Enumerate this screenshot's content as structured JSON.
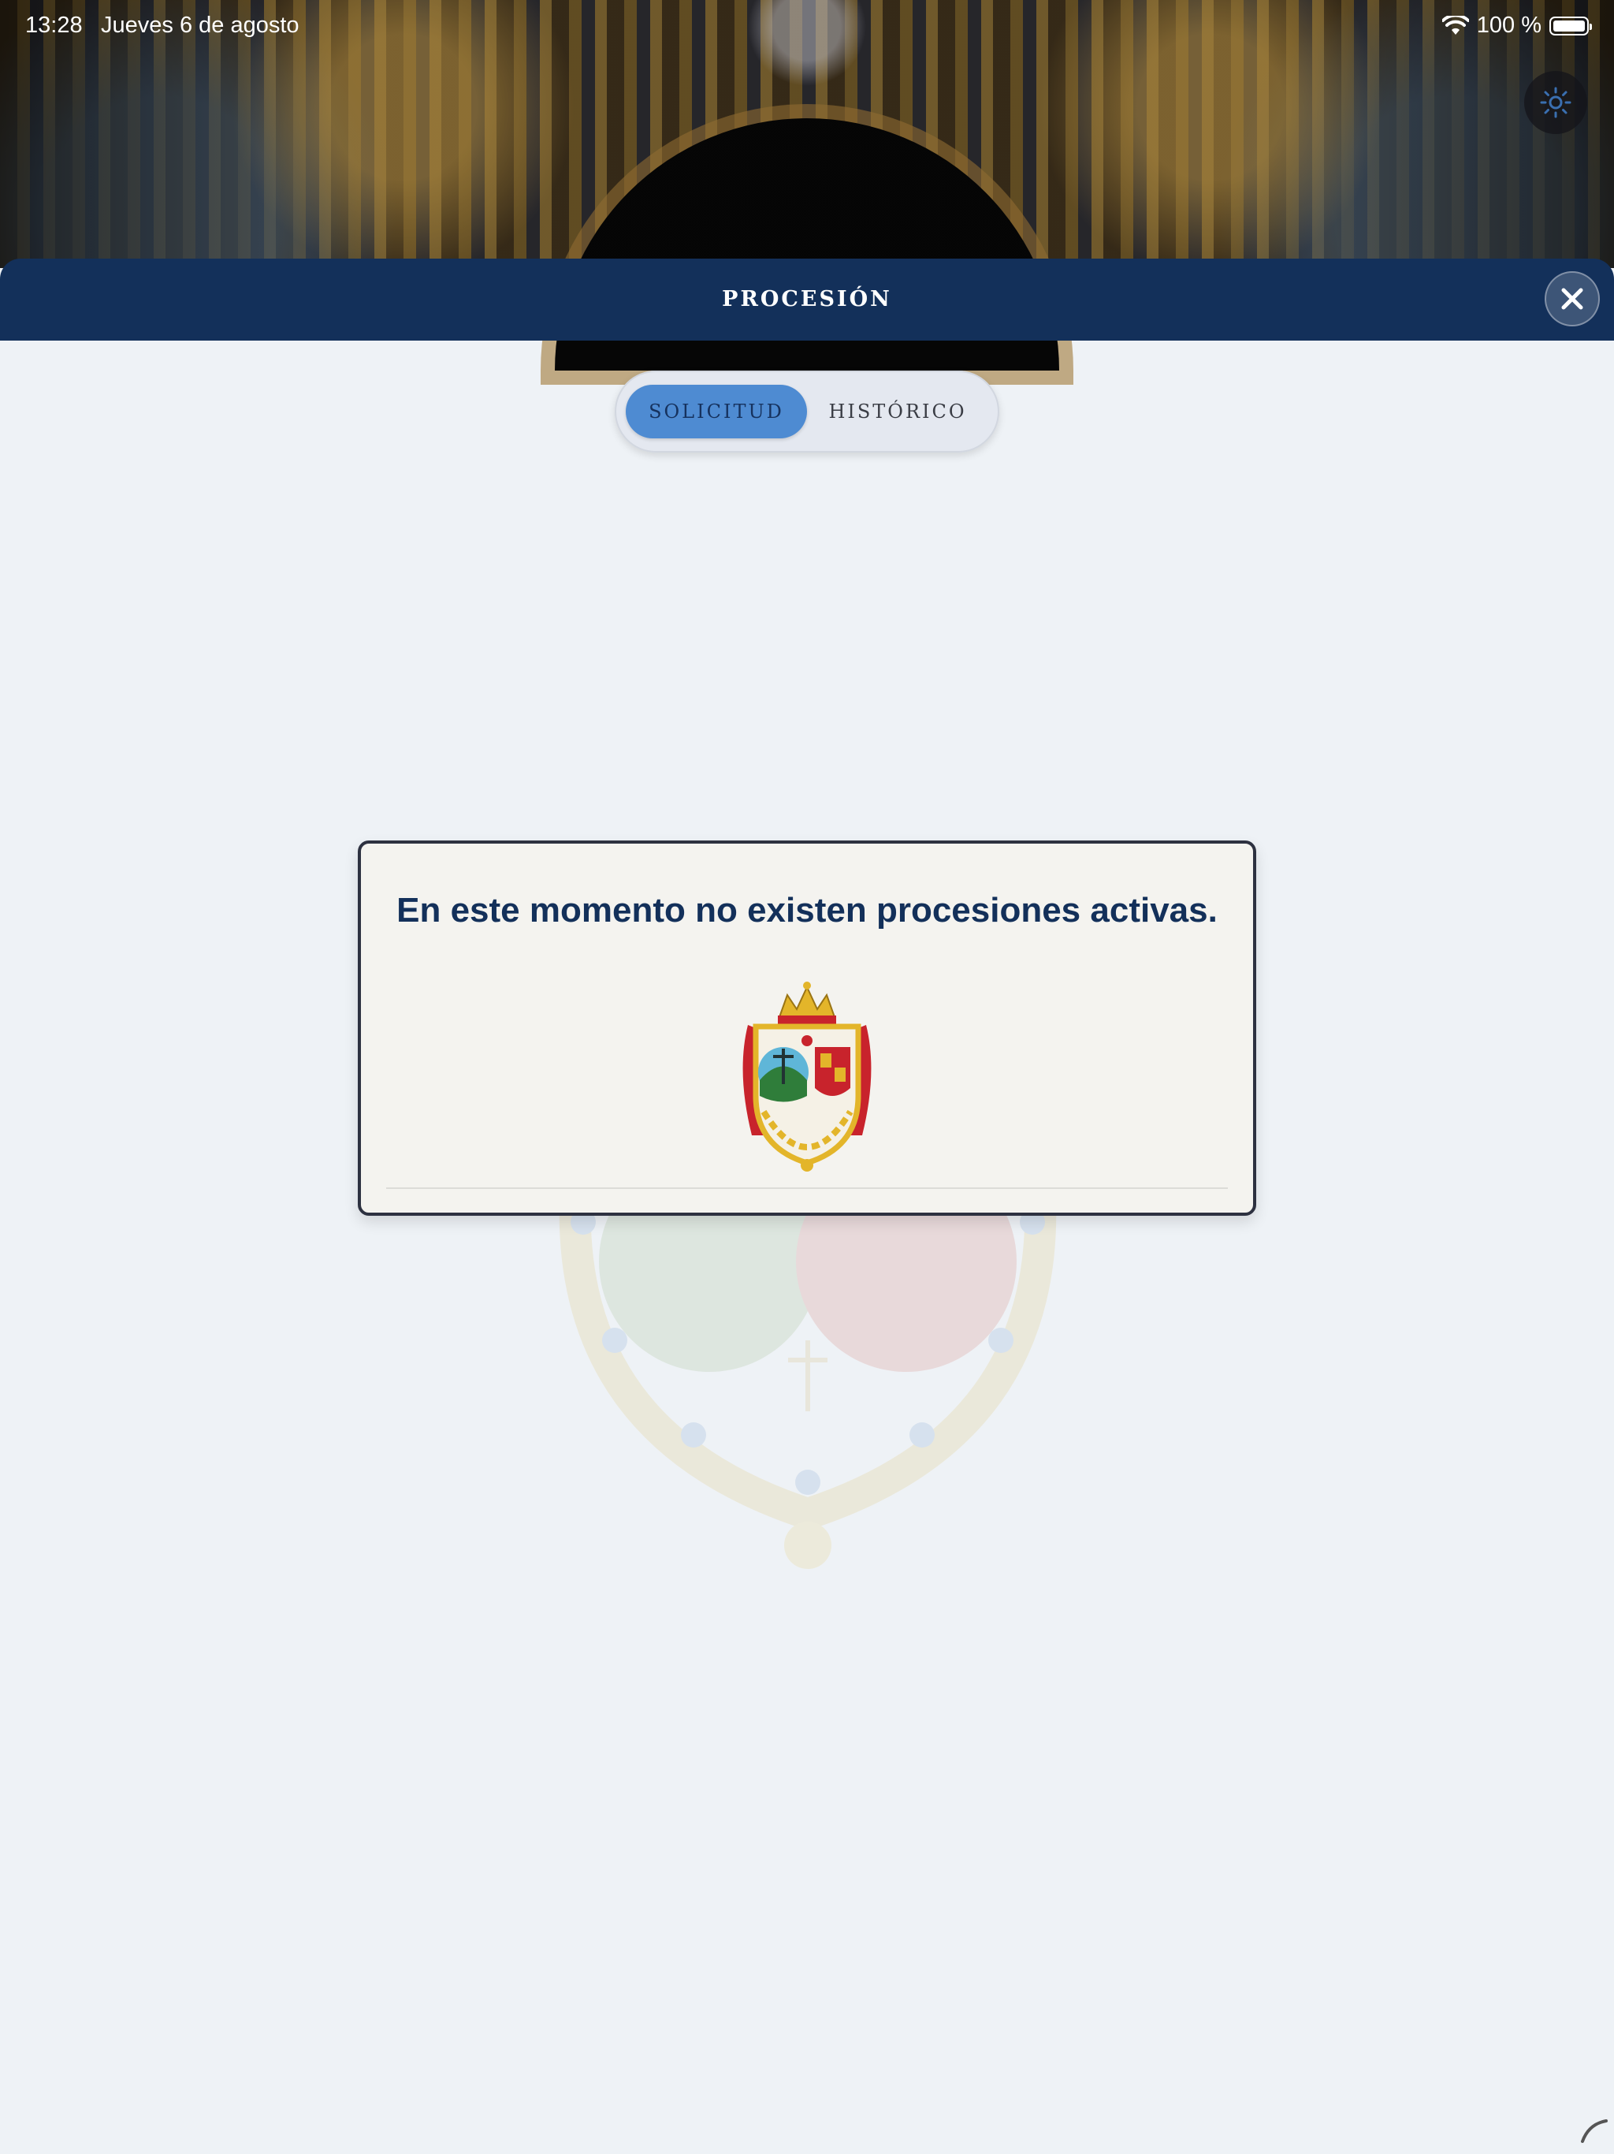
{
  "status_bar": {
    "time": "13:28",
    "date": "Jueves 6 de agosto",
    "battery": "100 %",
    "icons": [
      "wifi-icon",
      "battery-icon"
    ]
  },
  "header": {
    "title": "PROCESIÓN",
    "close_icon": "close-icon",
    "theme_icon": "sun-icon"
  },
  "tabs": [
    {
      "label": "SOLICITUD",
      "active": true
    },
    {
      "label": "HISTÓRICO",
      "active": false
    }
  ],
  "empty_state": {
    "message": "En este momento no existen procesiones activas.",
    "image": "coat-of-arms"
  },
  "colors": {
    "nav": "#13305a",
    "accent": "#4e8bd2",
    "background": "#eef2f6",
    "card": "#f4f3ef"
  }
}
